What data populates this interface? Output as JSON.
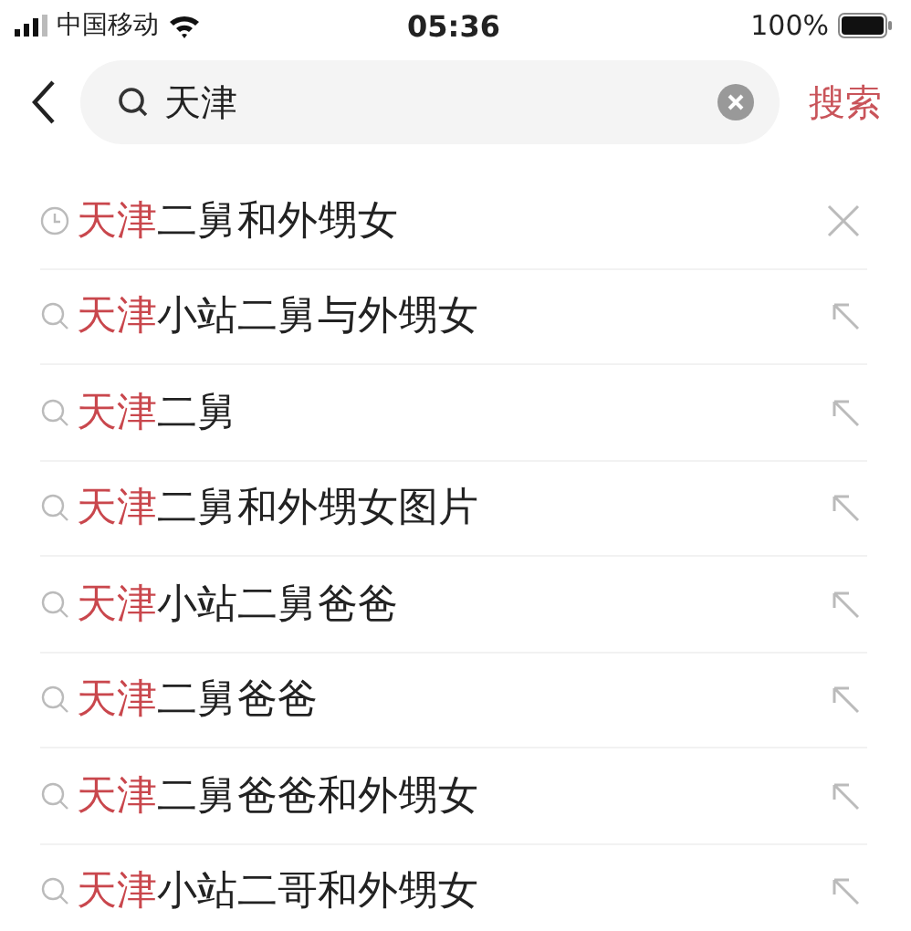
{
  "status_bar": {
    "carrier": "中国移动",
    "time": "05:36",
    "battery": "100%"
  },
  "search": {
    "value": "天津",
    "submit": "搜索"
  },
  "suggestions": [
    {
      "kind": "history",
      "highlight": "天津",
      "rest": "二舅和外甥女"
    },
    {
      "kind": "suggestion",
      "highlight": "天津",
      "rest": "小站二舅与外甥女"
    },
    {
      "kind": "suggestion",
      "highlight": "天津",
      "rest": "二舅"
    },
    {
      "kind": "suggestion",
      "highlight": "天津",
      "rest": "二舅和外甥女图片"
    },
    {
      "kind": "suggestion",
      "highlight": "天津",
      "rest": "小站二舅爸爸"
    },
    {
      "kind": "suggestion",
      "highlight": "天津",
      "rest": "二舅爸爸"
    },
    {
      "kind": "suggestion",
      "highlight": "天津",
      "rest": "二舅爸爸和外甥女"
    },
    {
      "kind": "suggestion",
      "highlight": "天津",
      "rest": "小站二哥和外甥女"
    }
  ]
}
